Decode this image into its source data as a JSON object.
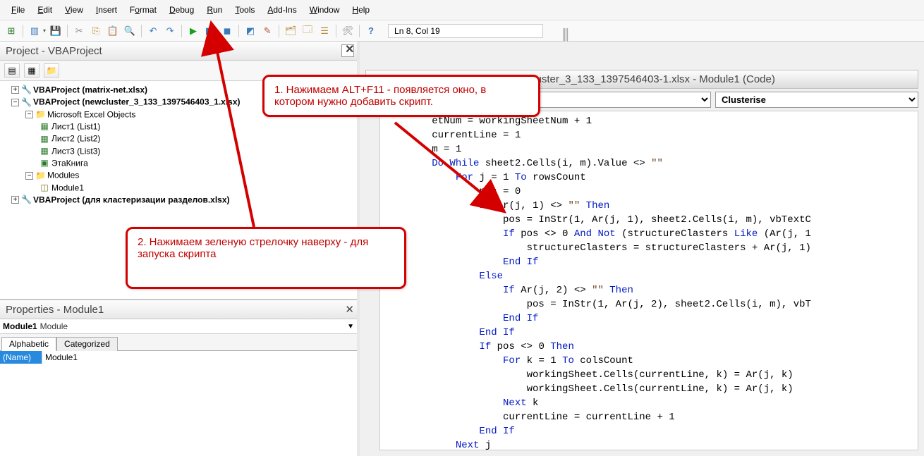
{
  "menu": {
    "file": "File",
    "edit": "Edit",
    "view": "View",
    "insert": "Insert",
    "format": "Format",
    "debug": "Debug",
    "run": "Run",
    "tools": "Tools",
    "addins": "Add-Ins",
    "window": "Window",
    "help": "Help"
  },
  "toolbar": {
    "cursor": "Ln 8, Col 19"
  },
  "project_panel": {
    "title": "Project - VBAProject",
    "tree": {
      "p1": "VBAProject (matrix-net.xlsx)",
      "p2": "VBAProject (newcluster_3_133_1397546403_1.xlsx)",
      "folder_objs": "Microsoft Excel Objects",
      "sheet1": "Лист1 (List1)",
      "sheet2": "Лист2 (List2)",
      "sheet3": "Лист3 (List3)",
      "workbook": "ЭтаКнига",
      "folder_mods": "Modules",
      "mod1": "Module1",
      "p3": "VBAProject (для кластеризации разделов.xlsx)"
    }
  },
  "props_panel": {
    "title": "Properties - Module1",
    "obj_name": "Module1",
    "obj_type": "Module",
    "tab_alpha": "Alphabetic",
    "tab_cat": "Categorized",
    "row_name_k": "(Name)",
    "row_name_v": "Module1"
  },
  "code_window": {
    "title": "newcluster_3_133_1397546403-1.xlsx - Module1 (Code)",
    "proc": "Clusterise",
    "lines": [
      {
        "indent": 2,
        "raw": "etNum = workingSheetNum + 1"
      },
      {
        "indent": 2,
        "raw": "currentLine = 1"
      },
      {
        "indent": 2,
        "raw": "m = 1"
      },
      {
        "indent": 2,
        "raw": "<kw>Do While</kw> sheet2.Cells(i, m).Value <> <str>\"\"</str>"
      },
      {
        "indent": 3,
        "raw": "<kw>For</kw> j = 1 <kw>To</kw> rowsCount"
      },
      {
        "indent": 4,
        "raw": "pos = 0"
      },
      {
        "indent": 4,
        "raw": "<kw>If</kw> Ar(j, 1) <> <str>\"\"</str> <kw>Then</kw>"
      },
      {
        "indent": 5,
        "raw": "pos = InStr(1, Ar(j, 1), sheet2.Cells(i, m), vbTextC"
      },
      {
        "indent": 5,
        "raw": "<kw>If</kw> pos <> 0 <kw>And Not</kw> (structureClasters <kw>Like</kw> (Ar(j, 1"
      },
      {
        "indent": 6,
        "raw": "structureClasters = structureClasters + Ar(j, 1)"
      },
      {
        "indent": 5,
        "raw": "<kw>End If</kw>"
      },
      {
        "indent": 4,
        "raw": "<kw>Else</kw>"
      },
      {
        "indent": 5,
        "raw": "<kw>If</kw> Ar(j, 2) <> <str>\"\"</str> <kw>Then</kw>"
      },
      {
        "indent": 6,
        "raw": "pos = InStr(1, Ar(j, 2), sheet2.Cells(i, m), vbT"
      },
      {
        "indent": 5,
        "raw": "<kw>End If</kw>"
      },
      {
        "indent": 4,
        "raw": "<kw>End If</kw>"
      },
      {
        "indent": 4,
        "raw": "<kw>If</kw> pos <> 0 <kw>Then</kw>"
      },
      {
        "indent": 5,
        "raw": "<kw>For</kw> k = 1 <kw>To</kw> colsCount"
      },
      {
        "indent": 6,
        "raw": "workingSheet.Cells(currentLine, k) = Ar(j, k)"
      },
      {
        "indent": 6,
        "raw": "workingSheet.Cells(currentLine, k) = Ar(j, k)"
      },
      {
        "indent": 5,
        "raw": "<kw>Next</kw> k"
      },
      {
        "indent": 5,
        "raw": "currentLine = currentLine + 1"
      },
      {
        "indent": 4,
        "raw": "<kw>End If</kw>"
      },
      {
        "indent": 3,
        "raw": "<kw>Next</kw> j"
      }
    ]
  },
  "callouts": {
    "c1": "1. Нажимаем ALT+F11  - появляется окно, в котором нужно добавить скрипт.",
    "c2": "2.  Нажимаем зеленую стрелочку наверху - для запуска скрипта"
  }
}
